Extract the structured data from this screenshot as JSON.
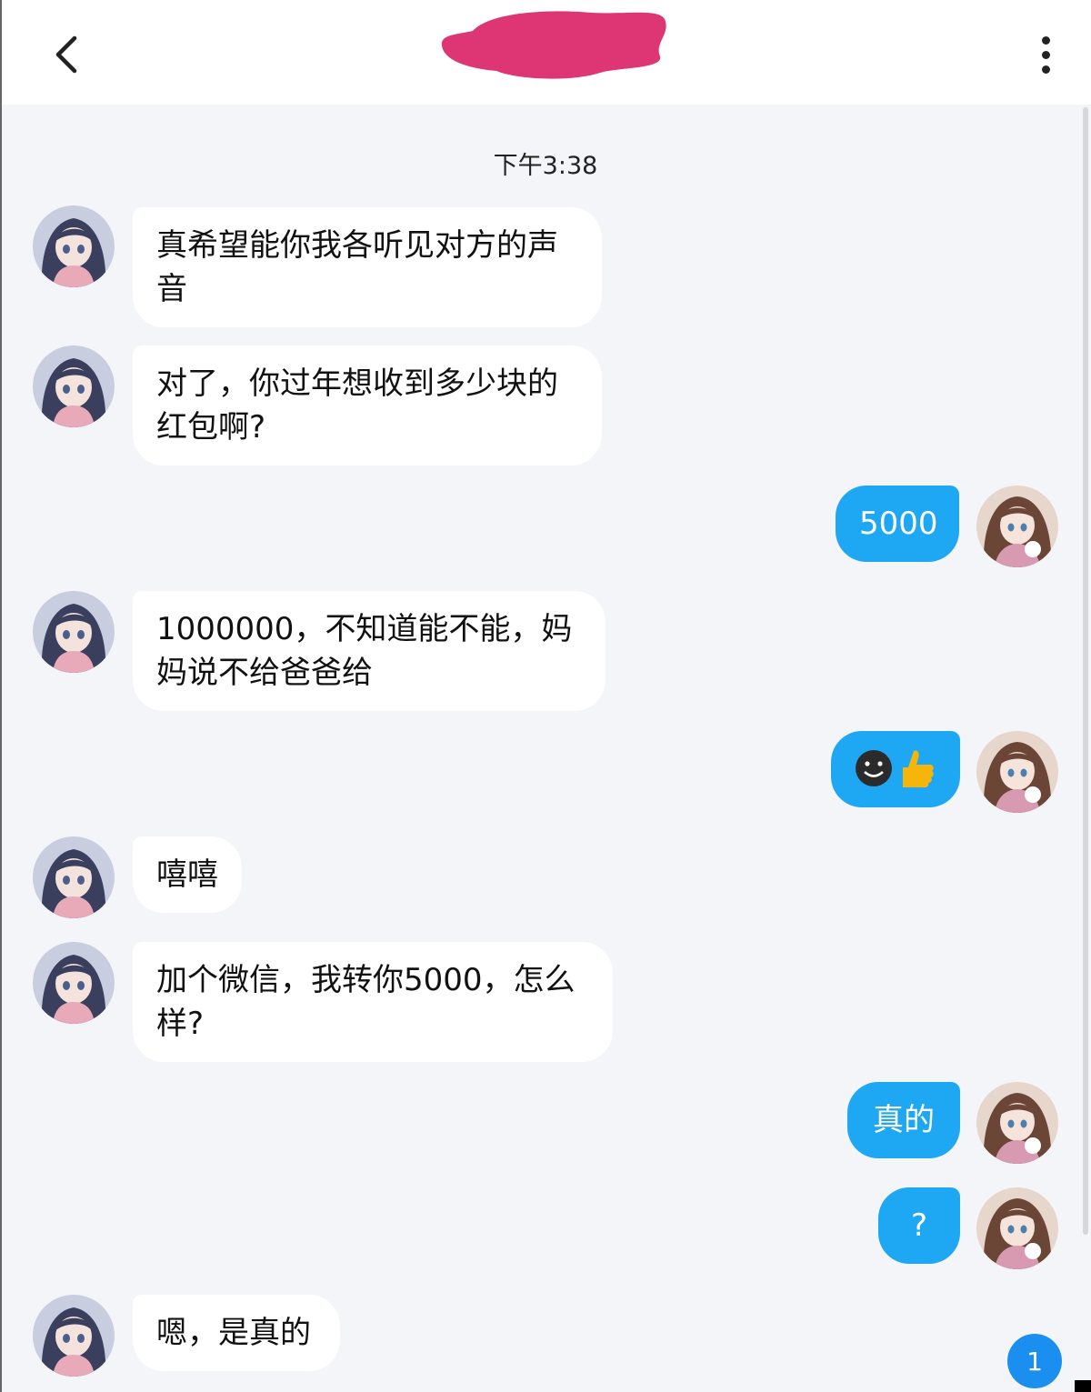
{
  "header": {
    "back_icon": "chevron-left-icon",
    "more_icon": "more-vertical-icon"
  },
  "time_label": "下午3:38",
  "colors": {
    "incoming_bubble": "#ffffff",
    "outgoing_bubble": "#1ea7f2",
    "background": "#f4f5f8",
    "redaction": "#de3674",
    "badge": "#1a8ff0"
  },
  "messages": [
    {
      "side": "in",
      "text": "真希望能你我各听见对方的声音"
    },
    {
      "side": "in",
      "text": "对了，你过年想收到多少块的红包啊?"
    },
    {
      "side": "out",
      "text": "5000"
    },
    {
      "side": "in",
      "text": "1000000，不知道能不能，妈妈说不给爸爸给"
    },
    {
      "side": "out",
      "text": "emoji: dark-smiley-face + thumbs-up"
    },
    {
      "side": "in",
      "text": "嘻嘻"
    },
    {
      "side": "in",
      "text": "加个微信，我转你5000，怎么样?"
    },
    {
      "side": "out",
      "text": "真的"
    },
    {
      "side": "out",
      "text": "?"
    },
    {
      "side": "in",
      "text": "嗯，是真的"
    }
  ],
  "unread_badge": "1"
}
